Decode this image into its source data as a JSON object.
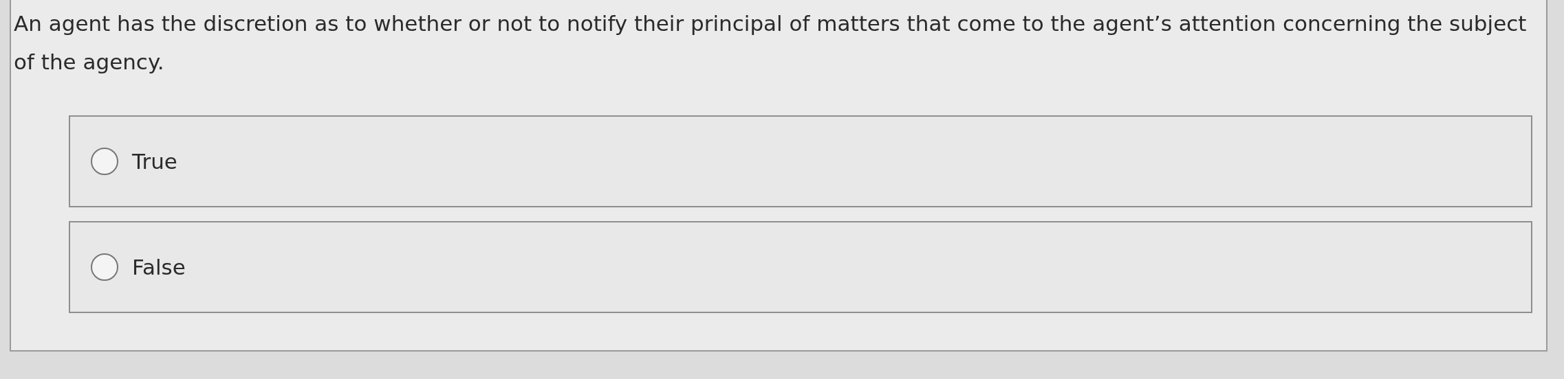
{
  "question": "An agent has the discretion as to whether or not to notify their principal of matters that come to the agent’s attention concerning the subject of the agency.",
  "options": [
    {
      "label": "True",
      "selected": false
    },
    {
      "label": "False",
      "selected": false
    }
  ]
}
